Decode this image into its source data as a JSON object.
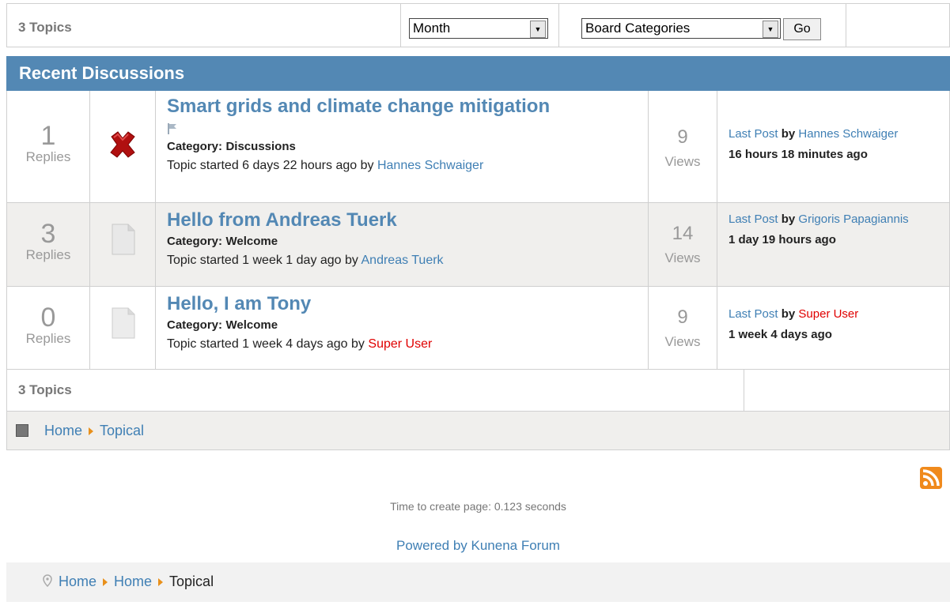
{
  "toolbar": {
    "topic_count": "3 Topics",
    "period_select": "Month",
    "category_select": "Board Categories",
    "go_label": "Go"
  },
  "header": {
    "title": "Recent Discussions"
  },
  "topics": [
    {
      "replies": "1",
      "replies_label": "Replies",
      "title": "Smart grids and climate change mitigation",
      "category_label": "Category:",
      "category": "Discussions",
      "started": "Topic started 6 days 22 hours ago",
      "by": "by",
      "author": "Hannes Schwaiger",
      "views": "9",
      "views_label": "Views",
      "last_post": "Last Post",
      "lp_by": "by",
      "lp_author": "Hannes Schwaiger",
      "lp_time": "16 hours 18 minutes ago"
    },
    {
      "replies": "3",
      "replies_label": "Replies",
      "title": "Hello from Andreas Tuerk",
      "category_label": "Category:",
      "category": "Welcome",
      "started": "Topic started 1 week 1 day ago",
      "by": "by",
      "author": "Andreas Tuerk",
      "views": "14",
      "views_label": "Views",
      "last_post": "Last Post",
      "lp_by": "by",
      "lp_author": "Grigoris Papagiannis",
      "lp_time": "1 day 19 hours ago"
    },
    {
      "replies": "0",
      "replies_label": "Replies",
      "title": "Hello, I am Tony",
      "category_label": "Category:",
      "category": "Welcome",
      "started": "Topic started 1 week 4 days ago",
      "by": "by",
      "author": "Super User",
      "views": "9",
      "views_label": "Views",
      "last_post": "Last Post",
      "lp_by": "by",
      "lp_author": "Super User",
      "lp_time": "1 week 4 days ago"
    }
  ],
  "footer_count": "3 Topics",
  "breadcrumb1": [
    "Home",
    "Topical"
  ],
  "page_time": "Time to create page: 0.123 seconds",
  "powered_by": "Powered by Kunena Forum",
  "breadcrumb2": [
    "Home",
    "Home",
    "Topical"
  ],
  "colors": {
    "accent": "#5388b4",
    "link": "#3f7fb4",
    "alt_row": "#f0efed",
    "admin": "#e00000"
  }
}
